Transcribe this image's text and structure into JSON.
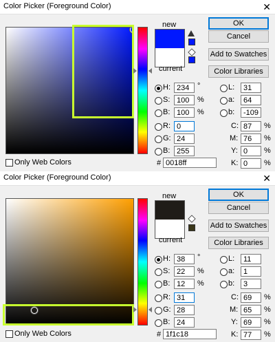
{
  "d1": {
    "title": "Color Picker (Foreground Color)",
    "close_glyph": "✕",
    "new_label": "new",
    "current_label": "current",
    "new_color": "#0018ff",
    "current_color": "#ffffff",
    "gamut_swatch": "#0018ff",
    "buttons": {
      "ok": "OK",
      "cancel": "Cancel",
      "add": "Add to Swatches",
      "libs": "Color Libraries"
    },
    "fields": {
      "h": {
        "label": "H:",
        "value": "234",
        "unit": "°"
      },
      "s": {
        "label": "S:",
        "value": "100",
        "unit": "%"
      },
      "b": {
        "label": "B:",
        "value": "100",
        "unit": "%"
      },
      "r": {
        "label": "R:",
        "value": "0"
      },
      "g": {
        "label": "G:",
        "value": "24"
      },
      "bl": {
        "label": "B:",
        "value": "255"
      },
      "l": {
        "label": "L:",
        "value": "31"
      },
      "a": {
        "label": "a:",
        "value": "64"
      },
      "lb": {
        "label": "b:",
        "value": "-109"
      },
      "c": {
        "label": "C:",
        "value": "87",
        "unit": "%"
      },
      "m": {
        "label": "M:",
        "value": "76",
        "unit": "%"
      },
      "y": {
        "label": "Y:",
        "value": "0",
        "unit": "%"
      },
      "k": {
        "label": "K:",
        "value": "0",
        "unit": "%"
      }
    },
    "hex_label": "#",
    "hex": "0018ff",
    "web_colors": "Only Web Colors",
    "hue_color": "#0018ff"
  },
  "d2": {
    "title": "Color Picker (Foreground Color)",
    "close_glyph": "✕",
    "new_label": "new",
    "current_label": "current",
    "new_color": "#1f1c18",
    "current_color": "#ffffff",
    "gamut_swatch": "#3a3618",
    "buttons": {
      "ok": "OK",
      "cancel": "Cancel",
      "add": "Add to Swatches",
      "libs": "Color Libraries"
    },
    "fields": {
      "h": {
        "label": "H:",
        "value": "38",
        "unit": "°"
      },
      "s": {
        "label": "S:",
        "value": "22",
        "unit": "%"
      },
      "b": {
        "label": "B:",
        "value": "12",
        "unit": "%"
      },
      "r": {
        "label": "R:",
        "value": "31"
      },
      "g": {
        "label": "G:",
        "value": "28"
      },
      "bl": {
        "label": "B:",
        "value": "24"
      },
      "l": {
        "label": "L:",
        "value": "11"
      },
      "a": {
        "label": "a:",
        "value": "1"
      },
      "lb": {
        "label": "b:",
        "value": "3"
      },
      "c": {
        "label": "C:",
        "value": "69",
        "unit": "%"
      },
      "m": {
        "label": "M:",
        "value": "65",
        "unit": "%"
      },
      "y": {
        "label": "Y:",
        "value": "69",
        "unit": "%"
      },
      "k": {
        "label": "K:",
        "value": "77",
        "unit": "%"
      }
    },
    "hex_label": "#",
    "hex": "1f1c18",
    "web_colors": "Only Web Colors",
    "hue_color": "#ff9f00"
  }
}
